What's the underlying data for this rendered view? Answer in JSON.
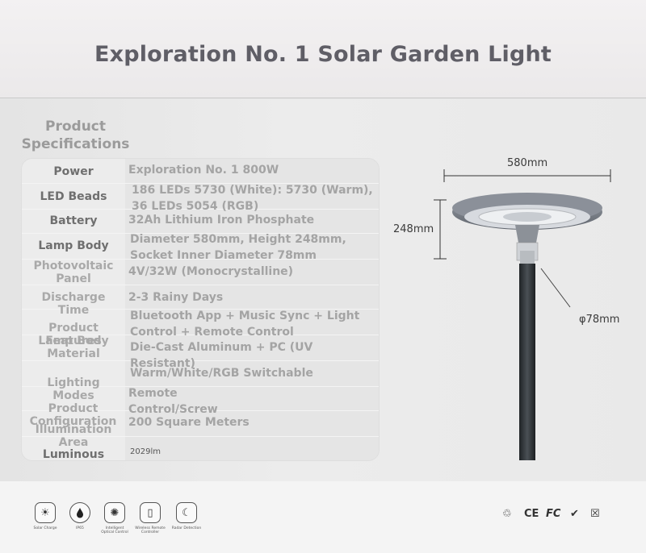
{
  "header": {
    "title": "Exploration No. 1 Solar Garden Light"
  },
  "specs": {
    "section_title": "Product Specifications",
    "rows": [
      {
        "label": "Power",
        "value": "Exploration No. 1 800W"
      },
      {
        "label": "LED Beads",
        "value": "186 LEDs 5730 (White): 5730 (Warm), 36 LEDs 5054 (RGB)"
      },
      {
        "label": "Battery",
        "value": "32Ah Lithium Iron Phosphate"
      },
      {
        "label": "Lamp Body",
        "value": "Diameter 580mm, Height 248mm, Socket Inner Diameter 78mm"
      },
      {
        "label": "Photovoltaic Panel",
        "value": "4V/32W (Monocrystalline)"
      },
      {
        "label": "Discharge Time",
        "value": "2-3 Rainy Days"
      },
      {
        "label": "Product Features",
        "value": "Bluetooth App + Music Sync + Light Control + Remote Control"
      },
      {
        "label": "Lamp Body Material",
        "value": "Die-Cast Aluminum + PC (UV Resistant)"
      },
      {
        "label": "Lighting Modes",
        "value": "Warm/White/RGB Switchable"
      },
      {
        "label": "Product Configuration",
        "value": "Remote Control/Screw"
      },
      {
        "label": "Illumination Area",
        "value": "200 Square Meters"
      },
      {
        "label": "Luminous Flux",
        "value": "2029lm"
      }
    ]
  },
  "diagram": {
    "width_label": "580mm",
    "height_label": "248mm",
    "pole_label": "φ78mm"
  },
  "features": [
    {
      "icon": "solar-charge-icon",
      "caption": "Solar Charge",
      "glyph": "☀"
    },
    {
      "icon": "waterproof-icon",
      "caption": "IP65",
      "glyph": "💧"
    },
    {
      "icon": "light-control-icon",
      "caption": "Intelligent Optical Control",
      "glyph": "✺"
    },
    {
      "icon": "remote-control-icon",
      "caption": "Wireless Remote Controller",
      "glyph": "▯"
    },
    {
      "icon": "radar-detection-icon",
      "caption": "Radar Detection",
      "glyph": "☾"
    }
  ],
  "certifications": [
    "♲",
    "CE",
    "FC",
    "✔",
    "☒"
  ],
  "colors": {
    "title": "#5f5e66",
    "pole": "#2f3336",
    "lamp": "#8a8f96"
  }
}
